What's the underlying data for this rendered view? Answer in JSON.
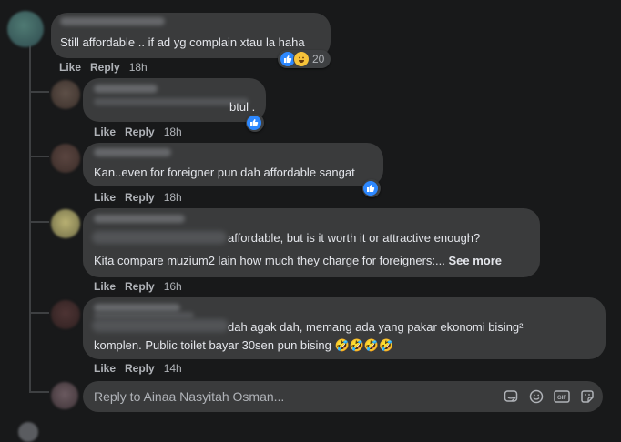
{
  "comments": [
    {
      "text": "Still affordable .. if ad yg complain xtau la haha",
      "like_label": "Like",
      "reply_label": "Reply",
      "time": "18h",
      "reaction_count": "20"
    },
    {
      "text": "btul .",
      "like_label": "Like",
      "reply_label": "Reply",
      "time": "18h"
    },
    {
      "text": "Kan..even for foreigner pun dah affordable sangat",
      "like_label": "Like",
      "reply_label": "Reply",
      "time": "18h"
    },
    {
      "line1": "affordable, but is it worth it or attractive enough?",
      "line2": "Kita compare muzium2 lain how much they charge for foreigners:...",
      "see_more": "See more",
      "like_label": "Like",
      "reply_label": "Reply",
      "time": "16h"
    },
    {
      "line1": "dah agak dah, memang ada yang pakar ekonomi bising²",
      "line2": "komplen. Public toilet bayar 30sen pun bising 🤣🤣🤣🤣",
      "like_label": "Like",
      "reply_label": "Reply",
      "time": "14h"
    }
  ],
  "reply_box": {
    "placeholder": "Reply to Ainaa Nasyitah Osman..."
  },
  "colors": {
    "background": "#18191a",
    "bubble": "#3a3b3c",
    "like_blue": "#2d88ff",
    "secondary_text": "#b0b3b8"
  },
  "icons": [
    "like-icon",
    "haha-icon",
    "sticker-icon",
    "emoji-icon",
    "gif-icon",
    "sticker-face-icon"
  ]
}
